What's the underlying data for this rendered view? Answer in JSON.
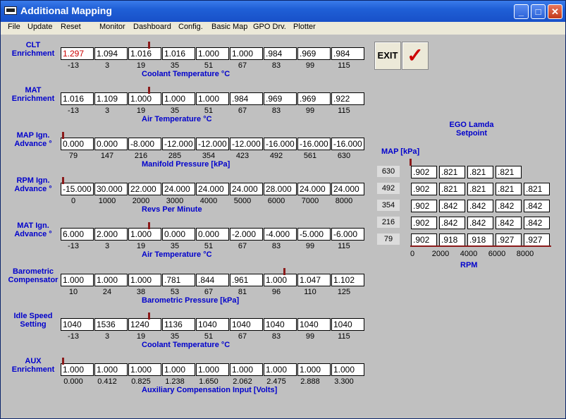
{
  "window": {
    "title": "Additional Mapping",
    "min": "_",
    "max": "□",
    "close": "✕"
  },
  "menu": [
    "File",
    "Update",
    "Reset",
    "Monitor",
    "Dashboard",
    "Config.",
    "Basic Map",
    "GPO Drv.",
    "Plotter"
  ],
  "buttons": {
    "exit": "EXIT",
    "ok": "✓"
  },
  "tables": [
    {
      "label": "CLT\nEnrichment",
      "values": [
        "1.297",
        "1.094",
        "1.016",
        "1.016",
        "1.000",
        "1.000",
        ".984",
        ".969",
        ".984"
      ],
      "ticks": [
        "-13",
        "3",
        "19",
        "35",
        "51",
        "67",
        "83",
        "99",
        "115"
      ],
      "axis": "Coolant Temperature °C",
      "marker": 2
    },
    {
      "label": "MAT\nEnrichment",
      "values": [
        "1.016",
        "1.109",
        "1.000",
        "1.000",
        "1.000",
        ".984",
        ".969",
        ".969",
        ".922"
      ],
      "ticks": [
        "-13",
        "3",
        "19",
        "35",
        "51",
        "67",
        "83",
        "99",
        "115"
      ],
      "axis": "Air Temperature °C",
      "marker": 2
    },
    {
      "label": "MAP Ign.\nAdvance °",
      "values": [
        "0.000",
        "0.000",
        "-8.000",
        "-12.000",
        "-12.000",
        "-12.000",
        "-16.000",
        "-16.000",
        "-16.000"
      ],
      "ticks": [
        "79",
        "147",
        "216",
        "285",
        "354",
        "423",
        "492",
        "561",
        "630"
      ],
      "axis": "Manifold Pressure [kPa]",
      "marker": 0
    },
    {
      "label": "RPM Ign.\nAdvance °",
      "values": [
        "-15.000",
        "30.000",
        "22.000",
        "24.000",
        "24.000",
        "24.000",
        "28.000",
        "24.000",
        "24.000"
      ],
      "ticks": [
        "0",
        "1000",
        "2000",
        "3000",
        "4000",
        "5000",
        "6000",
        "7000",
        "8000"
      ],
      "axis": "Revs Per Minute",
      "marker": 0
    },
    {
      "label": "MAT Ign.\nAdvance °",
      "values": [
        "6.000",
        "2.000",
        "1.000",
        "0.000",
        "0.000",
        "-2.000",
        "-4.000",
        "-5.000",
        "-6.000"
      ],
      "ticks": [
        "-13",
        "3",
        "19",
        "35",
        "51",
        "67",
        "83",
        "99",
        "115"
      ],
      "axis": "Air Temperature °C",
      "marker": 2
    },
    {
      "label": "Barometric\nCompensator",
      "values": [
        "1.000",
        "1.000",
        "1.000",
        ".781",
        ".844",
        ".961",
        "1.000",
        "1.047",
        "1.102"
      ],
      "ticks": [
        "10",
        "24",
        "38",
        "53",
        "67",
        "81",
        "96",
        "110",
        "125"
      ],
      "axis": "Barometric Pressure [kPa]",
      "marker": 6
    },
    {
      "label": "Idle Speed\nSetting",
      "values": [
        "1040",
        "1536",
        "1240",
        "1136",
        "1040",
        "1040",
        "1040",
        "1040",
        "1040"
      ],
      "ticks": [
        "-13",
        "3",
        "19",
        "35",
        "51",
        "67",
        "83",
        "99",
        "115"
      ],
      "axis": "Coolant Temperature °C",
      "marker": 2
    },
    {
      "label": "AUX\nEnrichment",
      "values": [
        "1.000",
        "1.000",
        "1.000",
        "1.000",
        "1.000",
        "1.000",
        "1.000",
        "1.000",
        "1.000"
      ],
      "ticks": [
        "0.000",
        "0.412",
        "0.825",
        "1.238",
        "1.650",
        "2.062",
        "2.475",
        "2.888",
        "3.300"
      ],
      "axis": "Auxiliary Compensation Input [Volts]",
      "marker": 0
    }
  ],
  "ego": {
    "title": "EGO Lamda\nSetpoint",
    "map_label": "MAP [kPa]",
    "rpm_label": "RPM",
    "map_values": [
      "630",
      "492",
      "354",
      "216",
      "79"
    ],
    "rpm_ticks": [
      "0",
      "2000",
      "4000",
      "6000",
      "8000"
    ],
    "grid": [
      [
        ".902",
        ".821",
        ".821",
        ".821",
        ""
      ],
      [
        ".902",
        ".821",
        ".821",
        ".821",
        ".821"
      ],
      [
        ".902",
        ".842",
        ".842",
        ".842",
        ".842"
      ],
      [
        ".902",
        ".842",
        ".842",
        ".842",
        ".842"
      ],
      [
        ".902",
        ".918",
        ".918",
        ".927",
        ".927"
      ]
    ]
  }
}
